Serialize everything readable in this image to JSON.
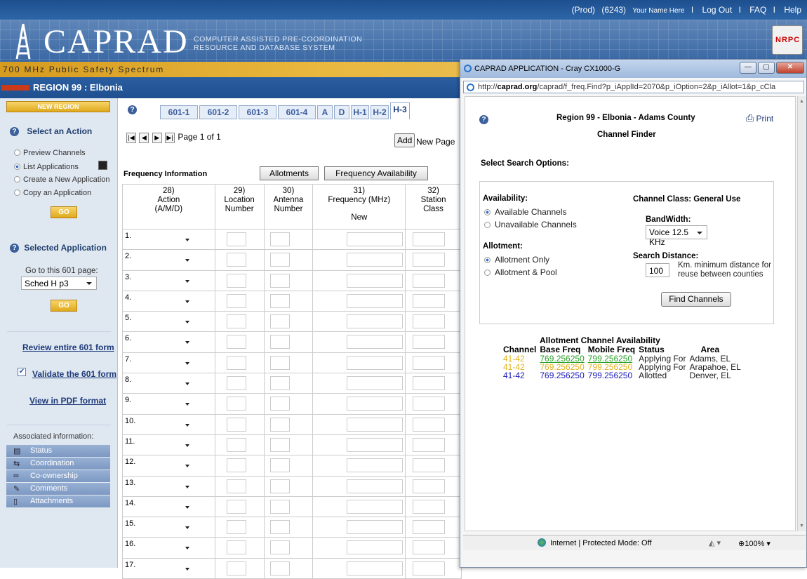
{
  "topbar": {
    "env": "(Prod)",
    "user_id": "(6243)",
    "user_name": "Your Name Here",
    "logout": "Log Out",
    "faq": "FAQ",
    "help": "Help",
    "sep": "I"
  },
  "banner": {
    "logo": "CAPRAD",
    "subtitle_line1": "COMPUTER ASSISTED PRE-COORDINATION",
    "subtitle_line2": "RESOURCE AND DATABASE SYSTEM",
    "badge": "NRPC"
  },
  "spectrum": "700 MHz Public Safety Spectrum",
  "region": "REGION 99 : Elbonia",
  "sidebar": {
    "new_region": "NEW REGION",
    "help_icon": "?",
    "select_action_title": "Select an Action",
    "actions": [
      {
        "label": "Preview Channels",
        "selected": false
      },
      {
        "label": "List Applications",
        "selected": true
      },
      {
        "label": "Create a New Application",
        "selected": false
      },
      {
        "label": "Copy an Application",
        "selected": false
      }
    ],
    "go": "GO",
    "selected_app_title": "Selected Application",
    "goto_label": "Go to this 601 page:",
    "goto_value": "Sched H p3",
    "review": "Review entire 601 form",
    "validate": "Validate the 601 form",
    "pdf": "View in PDF format",
    "assoc_title": "Associated information:",
    "assoc_items": [
      "Status",
      "Coordination",
      "Co-ownership",
      "Comments",
      "Attachments"
    ]
  },
  "main": {
    "help_icon": "?",
    "tabs": [
      "601-1",
      "601-2",
      "601-3",
      "601-4",
      "A",
      "D",
      "H-1",
      "H-2",
      "H-3"
    ],
    "active_tab": "H-3",
    "page_info": "Page 1 of 1",
    "add_button": "Add",
    "new_page": "New Page",
    "freq_info": "Frequency Information",
    "allotments_btn": "Allotments",
    "freq_avail_btn": "Frequency Availability",
    "columns": [
      {
        "num": "28)",
        "label": "Action",
        "sub": "(A/M/D)"
      },
      {
        "num": "29)",
        "label": "Location",
        "sub": "Number"
      },
      {
        "num": "30)",
        "label": "Antenna",
        "sub": "Number"
      },
      {
        "num": "31)",
        "label": "Frequency (MHz)",
        "sub": "New"
      },
      {
        "num": "32)",
        "label": "Station",
        "sub": "Class"
      }
    ],
    "rows": [
      "1.",
      "2.",
      "3.",
      "4.",
      "5.",
      "6.",
      "7.",
      "8.",
      "9.",
      "10.",
      "11.",
      "12.",
      "13.",
      "14.",
      "15.",
      "16.",
      "17."
    ]
  },
  "popup": {
    "window_title": "CAPRAD APPLICATION - Cray CX1000-G",
    "url_prefix": "http://",
    "url_domain": "caprad.org",
    "url_rest": "/caprad/f_freq.Find?p_iApplId=2070&p_iOption=2&p_iAllot=1&p_cCla",
    "help_icon": "?",
    "heading": "Region 99 - Elbonia - Adams County",
    "print": "Print",
    "subheading": "Channel Finder",
    "search_options": "Select Search Options:",
    "availability_label": "Availability:",
    "availability_options": [
      {
        "label": "Available Channels",
        "selected": true
      },
      {
        "label": "Unavailable Channels",
        "selected": false
      }
    ],
    "allotment_label": "Allotment:",
    "allotment_options": [
      {
        "label": "Allotment Only",
        "selected": true
      },
      {
        "label": "Allotment & Pool",
        "selected": false
      }
    ],
    "channel_class": "Channel Class: General Use",
    "bandwidth_label": "BandWidth:",
    "bandwidth_value": "Voice 12.5 KHz",
    "search_distance_label": "Search Distance:",
    "search_distance_value": "100",
    "distance_note_1": "Km. minimum distance for",
    "distance_note_2": "reuse between counties",
    "find_button": "Find Channels",
    "avail_title": "Allotment Channel Availability",
    "avail_columns": [
      "Channel",
      "Base Freq",
      "Mobile Freq",
      "Status",
      "Area"
    ],
    "avail_rows": [
      {
        "channel": "41-42",
        "base": "769.256250",
        "mobile": "799.256250",
        "status": "Applying For",
        "area": "Adams, EL",
        "color": "#e3b21c",
        "freq_color": "#2aa12a",
        "link": true
      },
      {
        "channel": "41-42",
        "base": "769.256250",
        "mobile": "799.256250",
        "status": "Applying For",
        "area": "Arapahoe, EL",
        "color": "#e3b21c",
        "freq_color": "#e3b21c",
        "link": false
      },
      {
        "channel": "41-42",
        "base": "769.256250",
        "mobile": "799.256250",
        "status": "Allotted",
        "area": "Denver, EL",
        "color": "#1a1ab5",
        "freq_color": "#1a1ab5",
        "link": false
      }
    ],
    "status_text": "Internet | Protected Mode: Off",
    "zoom": "100%"
  }
}
